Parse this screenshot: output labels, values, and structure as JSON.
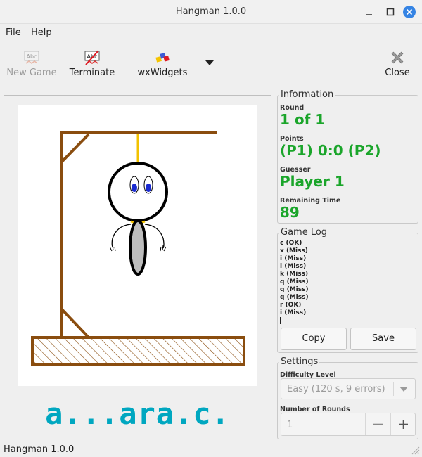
{
  "window": {
    "title": "Hangman 1.0.0"
  },
  "menu": {
    "file": "File",
    "help": "Help"
  },
  "toolbar": {
    "new_game": "New Game",
    "terminate": "Terminate",
    "wxwidgets": "wxWidgets",
    "close": "Close"
  },
  "game": {
    "word": "a...ara.c."
  },
  "info": {
    "title": "Information",
    "round_label": "Round",
    "round_value": "1 of 1",
    "points_label": "Points",
    "points_value": "(P1) 0:0 (P2)",
    "guesser_label": "Guesser",
    "guesser_value": "Player 1",
    "time_label": "Remaining Time",
    "time_value": "89"
  },
  "log": {
    "title": "Game Log",
    "entries": [
      "c (OK)",
      "x (Miss)",
      "i (Miss)",
      "l (Miss)",
      "k (Miss)",
      "q (Miss)",
      "q (Miss)",
      "q (Miss)",
      "r (OK)",
      "i (Miss)"
    ],
    "copy": "Copy",
    "save": "Save"
  },
  "settings": {
    "title": "Settings",
    "difficulty_label": "Difficulty Level",
    "difficulty_value": "Easy (120 s, 9 errors)",
    "rounds_label": "Number of Rounds",
    "rounds_value": "1"
  },
  "status": {
    "text": "Hangman 1.0.0"
  },
  "colors": {
    "accent_green": "#1aa52a",
    "word_cyan": "#00a7c0",
    "gallows_brown": "#8a4d0f",
    "rope_yellow": "#f2c200",
    "eye_blue": "#1a2bd0",
    "close_button": "#3584e4"
  }
}
